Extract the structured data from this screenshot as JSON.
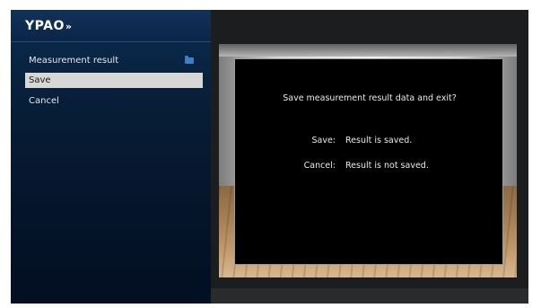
{
  "app": {
    "logo": "YPAO",
    "logo_mark": "»"
  },
  "menu": {
    "header": "Measurement result",
    "items": [
      {
        "label": "Save",
        "selected": true
      },
      {
        "label": "Cancel",
        "selected": false
      }
    ]
  },
  "dialog": {
    "title": "Save measurement result data and exit?",
    "options": [
      {
        "key": "Save:",
        "desc": "Result is saved."
      },
      {
        "key": "Cancel:",
        "desc": "Result is not saved."
      }
    ]
  },
  "colors": {
    "sidebar_bg": "#071d36",
    "selected_bg": "#d7d7d7",
    "accent": "#3f7ec4",
    "dialog_bg": "#000000"
  },
  "icons": {
    "header_icon": "folder-icon"
  }
}
